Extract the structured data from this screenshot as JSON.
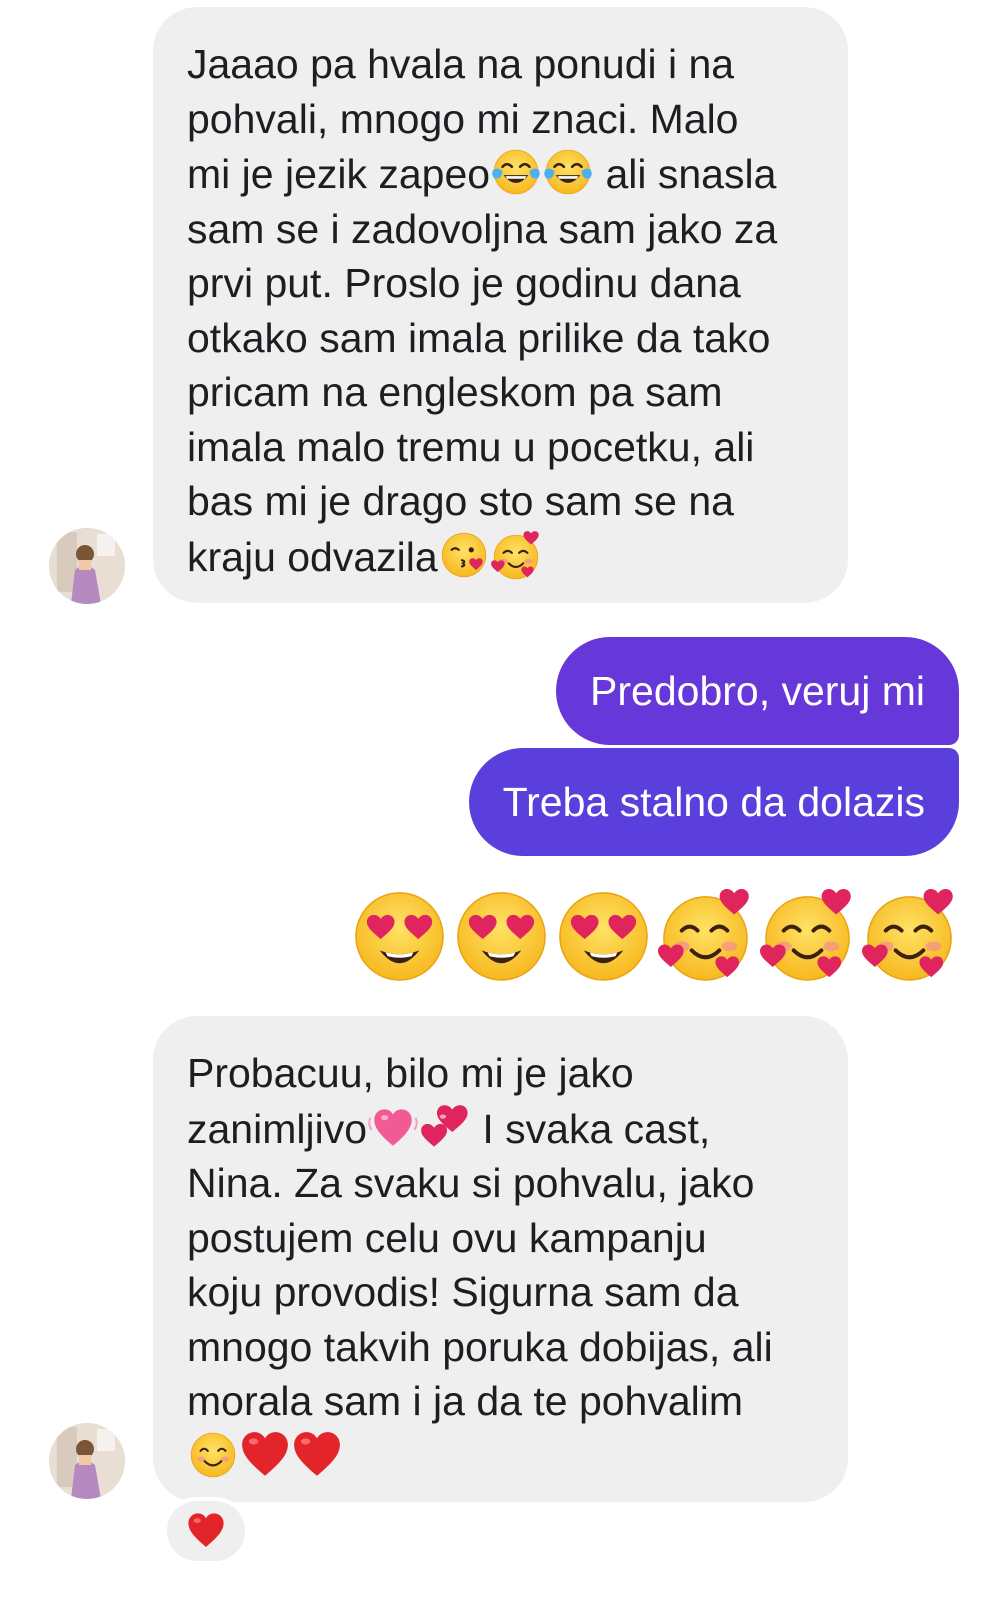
{
  "conversation": {
    "messages": [
      {
        "direction": "incoming",
        "lines": [
          "Jaaao pa hvala na ponudi i na",
          "pohvali, mnogo mi znaci. Malo",
          "mi je jezik zapeo",
          " ali snasla",
          "sam se i zadovoljna sam jako za",
          "prvi put. Proslo je godinu dana",
          "otkako sam imala prilike da tako",
          "pricam na engleskom pa sam",
          "imala malo tremu u pocetku, ali",
          "bas mi je drago sto sam se na",
          "kraju odvazila"
        ],
        "inline_emoji": [
          "face-with-tears-of-joy",
          "face-with-tears-of-joy",
          "face-blowing-kiss",
          "smiling-face-with-hearts"
        ]
      },
      {
        "direction": "outgoing",
        "text": "Predobro, veruj mi"
      },
      {
        "direction": "outgoing",
        "text": "Treba stalno da dolazis"
      },
      {
        "direction": "outgoing",
        "big_emoji": [
          "heart-eyes",
          "heart-eyes",
          "heart-eyes",
          "smiling-face-with-hearts",
          "smiling-face-with-hearts",
          "smiling-face-with-hearts"
        ]
      },
      {
        "direction": "incoming",
        "lines": [
          "Probacuu, bilo mi je jako",
          "zanimljivo",
          " I svaka cast,",
          "Nina. Za svaku si pohvalu, jako",
          "postujem celu ovu kampanju",
          "koju provodis! Sigurna sam da",
          "mnogo takvih poruka dobijas, ali",
          "morala sam i ja da te pohvalim"
        ],
        "inline_emoji": [
          "growing-heart",
          "two-hearts",
          "smiling-face-with-smiling-eyes",
          "red-heart",
          "red-heart"
        ],
        "reaction": "red-heart"
      }
    ],
    "colors": {
      "incoming_bubble": "#efefef",
      "outgoing_bubble_1": "#6637d9",
      "outgoing_bubble_2": "#5a3fdc",
      "outgoing_text": "#ffffff",
      "incoming_text": "#1c1e21"
    }
  }
}
